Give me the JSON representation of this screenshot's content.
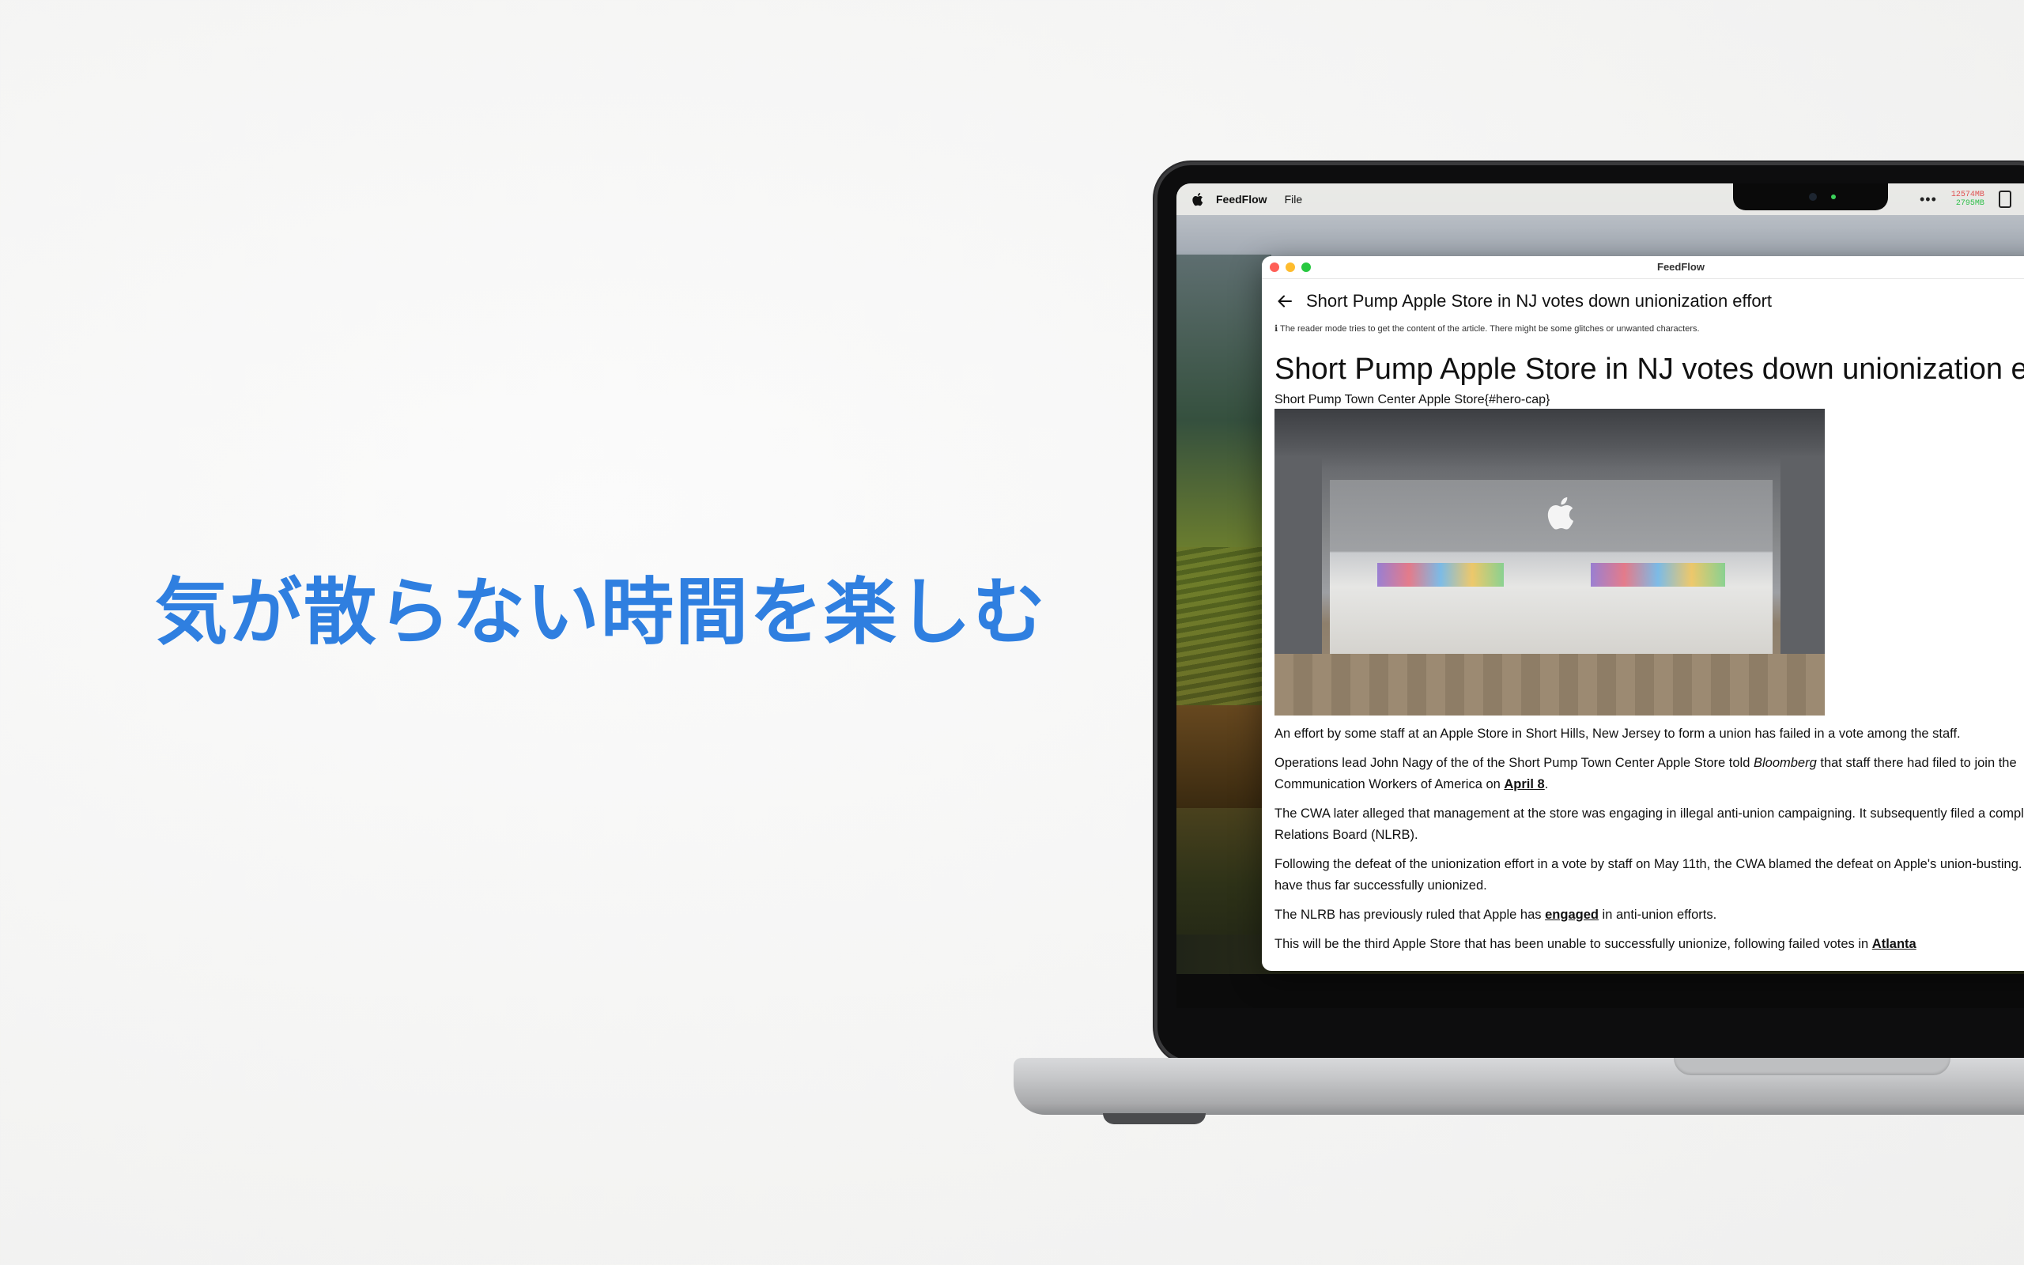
{
  "headline": "気が散らない時間を楽しむ",
  "menubar": {
    "app_name": "FeedFlow",
    "file_menu": "File",
    "more": "•••",
    "mem_top": "12574MB",
    "mem_bottom": "2795MB"
  },
  "window": {
    "title": "FeedFlow",
    "toolbar_title": "Short Pump Apple Store in NJ votes down unionization effort",
    "reader_note": "ℹ The reader mode tries to get the content of the article. There might be some glitches or unwanted characters."
  },
  "article": {
    "heading": "Short Pump Apple Store in NJ votes down unionization effort",
    "caption": "Short Pump Town Center Apple Store{#hero-cap}",
    "p1": "An effort by some staff at an Apple Store in Short Hills, New Jersey to form a union has failed in a vote among the staff.",
    "p2_a": "Operations lead John Nagy of the of the Short Pump Town Center Apple Store told ",
    "p2_em": "Bloomberg",
    "p2_b": " that staff there had filed to join the",
    "p2_c": "Communication Workers of America on ",
    "p2_link": "April 8",
    "p2_d": ".",
    "p3_a": "The CWA later alleged that management at the store was engaging in illegal anti-union campaigning. It subsequently filed a complaint with the National Labor",
    "p3_b": "Relations Board (NLRB).",
    "p4_a": "Following the defeat of the unionization effort in a vote by staff on May 11th, the CWA blamed the defeat on Apple's union-busting. Two Apple Stores",
    "p4_b": "have thus far successfully unionized.",
    "p5_a": "The NLRB has previously ruled that Apple has ",
    "p5_link": "engaged",
    "p5_b": " in anti-union efforts.",
    "p6_a": "This will be the third Apple Store that has been unable to successfully unionize, following failed votes in ",
    "p6_link": "Atlanta"
  }
}
